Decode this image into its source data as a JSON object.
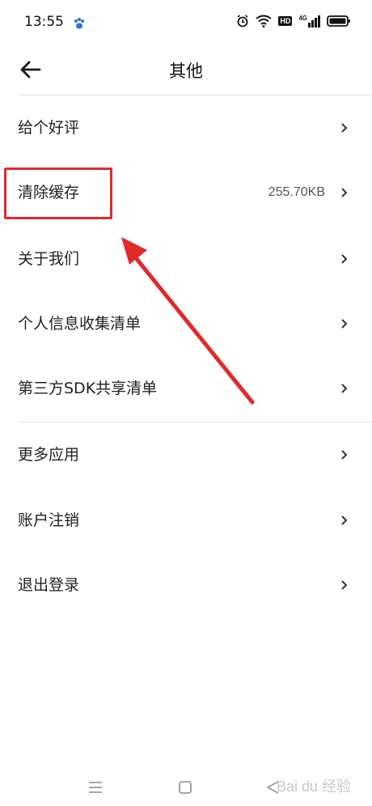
{
  "status_bar": {
    "time": "13:55",
    "hd_badge": "HD",
    "network": "4G"
  },
  "header": {
    "title": "其他"
  },
  "menu_group_1": [
    {
      "label": "给个好评",
      "value": ""
    },
    {
      "label": "清除缓存",
      "value": "255.70KB"
    },
    {
      "label": "关于我们",
      "value": ""
    },
    {
      "label": "个人信息收集清单",
      "value": ""
    },
    {
      "label": "第三方SDK共享清单",
      "value": ""
    }
  ],
  "menu_group_2": [
    {
      "label": "更多应用"
    },
    {
      "label": "账户注销"
    },
    {
      "label": "退出登录"
    }
  ],
  "annotation": {
    "color": "#e02a2a"
  },
  "watermark": {
    "text": "Bai du 经验"
  }
}
